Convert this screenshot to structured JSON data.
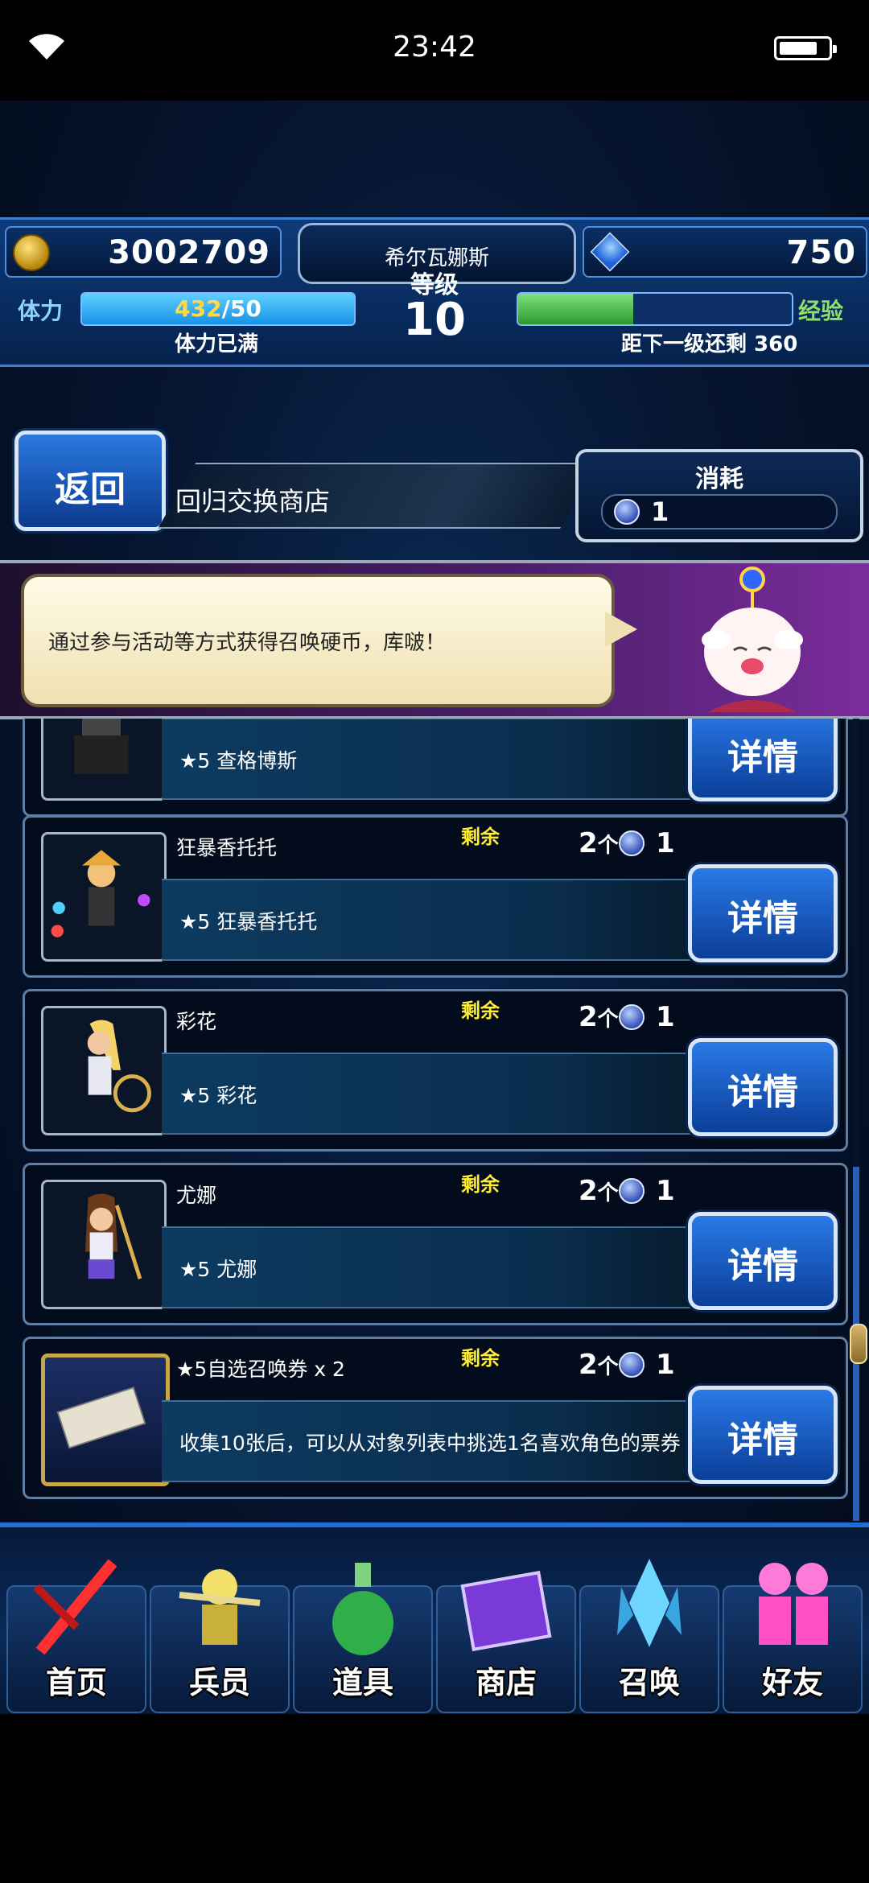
{
  "status_bar": {
    "time": "23:42"
  },
  "header": {
    "gil": "3002709",
    "gems": "750",
    "player_name": "希尔瓦娜斯",
    "level_label": "等级",
    "level": "10",
    "stamina_label": "体力",
    "stamina_current": "432",
    "stamina_max": "/50",
    "stamina_status": "体力已满",
    "exp_label": "经验",
    "exp_fraction": 0.42,
    "exp_status": "距下一级还剩 360"
  },
  "nav_top": {
    "back_label": "返回",
    "shop_title": "回归交换商店",
    "cost_label": "消耗",
    "cost_value": "1"
  },
  "banner": {
    "message": "通过参与活动等方式获得召唤硬币，库啵！"
  },
  "items": [
    {
      "name": "",
      "desc": "★5 查格博斯",
      "detail": "详情"
    },
    {
      "name": "狂暴香托托",
      "remain": "剩余",
      "cost_count": "2",
      "cost_unit": "个",
      "stock": "1",
      "desc": "★5 狂暴香托托",
      "detail": "详情"
    },
    {
      "name": "彩花",
      "remain": "剩余",
      "cost_count": "2",
      "cost_unit": "个",
      "stock": "1",
      "desc": "★5 彩花",
      "detail": "详情"
    },
    {
      "name": "尤娜",
      "remain": "剩余",
      "cost_count": "2",
      "cost_unit": "个",
      "stock": "1",
      "desc": "★5 尤娜",
      "detail": "详情"
    },
    {
      "name": "★5自选召唤券 x 2",
      "remain": "剩余",
      "cost_count": "2",
      "cost_unit": "个",
      "stock": "1",
      "desc": "收集10张后，可以从对象列表中挑选1名喜欢角色的票券",
      "detail": "详情"
    }
  ],
  "bottom_nav": [
    {
      "label": "首页",
      "icon": "sword-icon"
    },
    {
      "label": "兵员",
      "icon": "warrior-icon"
    },
    {
      "label": "道具",
      "icon": "potion-icon"
    },
    {
      "label": "商店",
      "icon": "shop-icon"
    },
    {
      "label": "召唤",
      "icon": "crystal-icon"
    },
    {
      "label": "好友",
      "icon": "friends-icon"
    }
  ],
  "colors": {
    "accent": "#1f6ed8",
    "remain": "#ffee33",
    "stamina_value": "#ffd94a"
  }
}
